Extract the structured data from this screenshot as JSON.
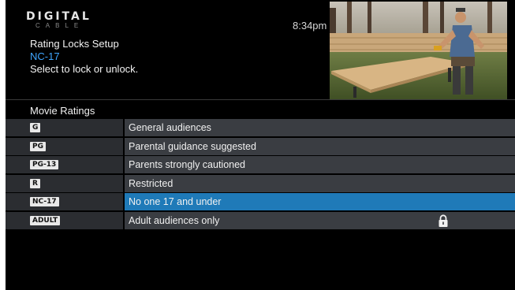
{
  "brand": {
    "name": "DIGITAL",
    "sub": "CABLE"
  },
  "clock": "8:34pm",
  "header": {
    "title": "Rating Locks Setup",
    "selected_rating": "NC-17",
    "instruction": "Select to lock or unlock."
  },
  "section_label": "Movie Ratings",
  "ratings": [
    {
      "code": "G",
      "description": "General audiences",
      "selected": false,
      "locked": false
    },
    {
      "code": "PG",
      "description": "Parental guidance suggested",
      "selected": false,
      "locked": false
    },
    {
      "code": "PG-13",
      "description": "Parents strongly cautioned",
      "selected": false,
      "locked": false
    },
    {
      "code": "R",
      "description": "Restricted",
      "selected": false,
      "locked": false
    },
    {
      "code": "NC-17",
      "description": "No one 17 and under",
      "selected": true,
      "locked": false
    },
    {
      "code": "ADULT",
      "description": "Adult audiences only",
      "selected": false,
      "locked": true
    }
  ],
  "icons": {
    "lock": "lock-icon"
  },
  "colors": {
    "background": "#000000",
    "row_code_bg": "#2b2d31",
    "row_desc_bg": "#3a3d42",
    "selected_row": "#1f7ab8",
    "accent_text": "#3fa6ff"
  }
}
